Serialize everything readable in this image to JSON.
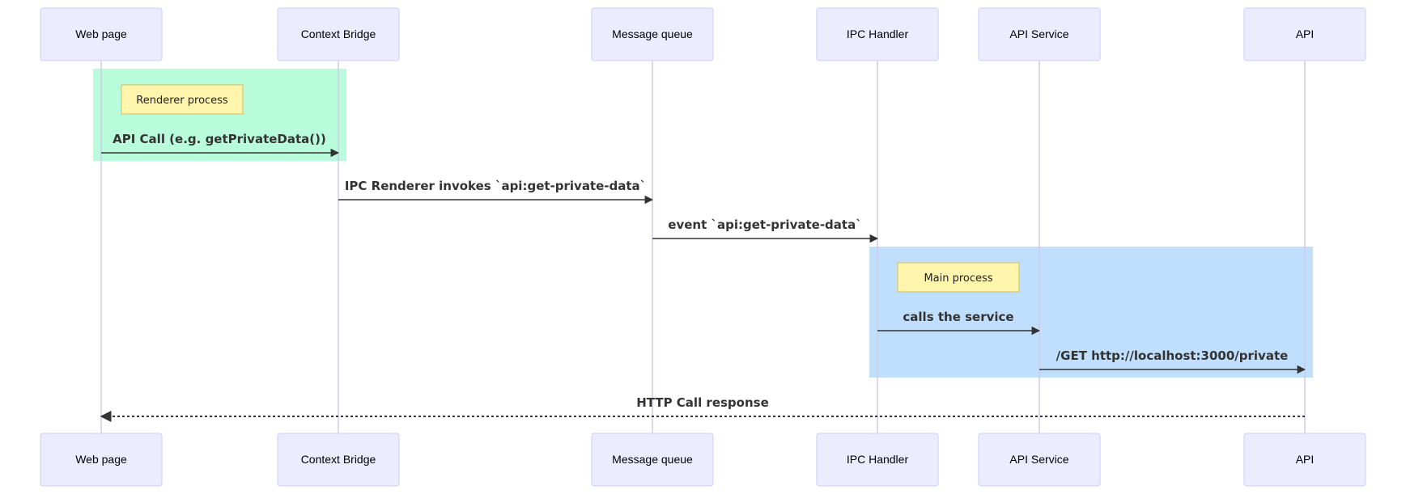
{
  "diagram": {
    "type": "sequence",
    "participants": [
      {
        "id": "webpage",
        "label": "Web page"
      },
      {
        "id": "bridge",
        "label": "Context Bridge"
      },
      {
        "id": "queue",
        "label": "Message queue"
      },
      {
        "id": "ipc",
        "label": "IPC Handler"
      },
      {
        "id": "service",
        "label": "API Service"
      },
      {
        "id": "api",
        "label": "API"
      }
    ],
    "groups": [
      {
        "label": "Renderer process",
        "color": "#b9fcdc"
      },
      {
        "label": "Main process",
        "color": "#bfdffc"
      }
    ],
    "messages": [
      {
        "from": "webpage",
        "to": "bridge",
        "label": "API Call (e.g. getPrivateData())",
        "style": "solid"
      },
      {
        "from": "bridge",
        "to": "queue",
        "label": "IPC Renderer invokes `api:get-private-data`",
        "style": "solid"
      },
      {
        "from": "queue",
        "to": "ipc",
        "label": "event `api:get-private-data`",
        "style": "solid"
      },
      {
        "from": "ipc",
        "to": "service",
        "label": "calls the service",
        "style": "solid"
      },
      {
        "from": "service",
        "to": "api",
        "label": "/GET http://localhost:3000/private",
        "style": "solid"
      },
      {
        "from": "api",
        "to": "webpage",
        "label": "HTTP Call response",
        "style": "dotted"
      }
    ]
  }
}
